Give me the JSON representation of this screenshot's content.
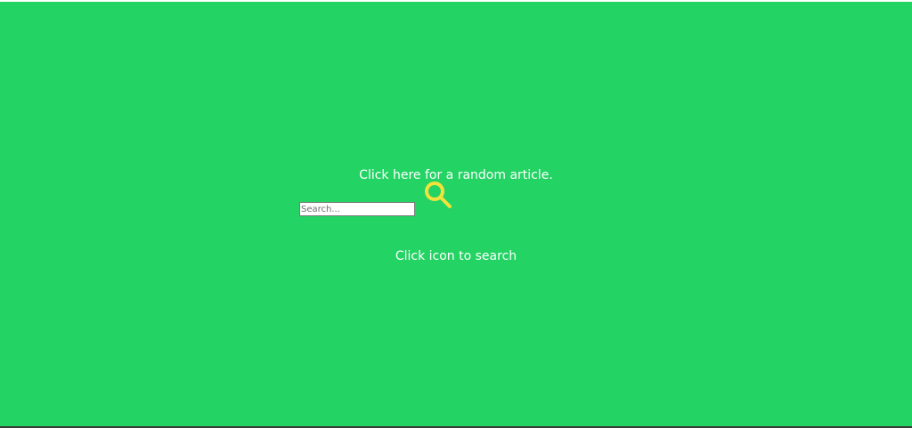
{
  "random_link": {
    "label": "Click here for a random article."
  },
  "search": {
    "value": "",
    "placeholder": "Search...",
    "icon": "magnifier-icon",
    "hint": "Click icon to search"
  },
  "colors": {
    "background": "#23d364",
    "text": "#ffffff",
    "icon": "#f2e23a"
  }
}
